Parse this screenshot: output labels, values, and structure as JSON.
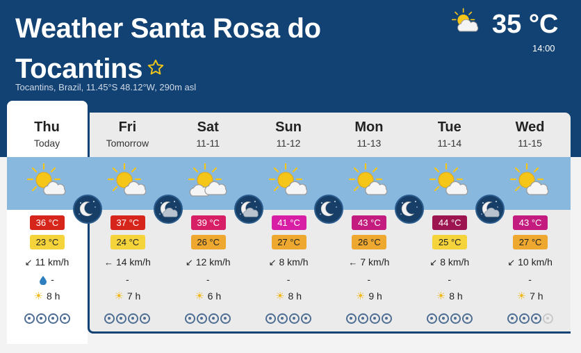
{
  "header": {
    "title": "Weather Santa Rosa do Tocantins",
    "subtitle": "Tocantins, Brazil, 11.45°S 48.12°W, 290m asl",
    "current_temp": "35 °C",
    "current_time": "14:00",
    "current_icon": "sun-cloud-icon",
    "favorite_icon": "star-outline-icon"
  },
  "colors": {
    "header_bg": "#124273",
    "sky_band": "#89b8df",
    "panel_bg": "#ebebeb",
    "uv_active": "#4e6e93",
    "uv_inactive": "#c9c9c9"
  },
  "days": [
    {
      "name": "Thu",
      "sub": "Today",
      "max": "36 °C",
      "max_color": "#d6261b",
      "min": "23 °C",
      "min_color": "#f5d33a",
      "wind_dir": "↙",
      "wind": "11 km/h",
      "rain": "-",
      "rain_icon": true,
      "sun": "8 h",
      "uv": 4,
      "weather_icon": "sun-cloud-icon"
    },
    {
      "name": "Fri",
      "sub": "Tomorrow",
      "max": "37 °C",
      "max_color": "#d6261b",
      "min": "24 °C",
      "min_color": "#f5d33a",
      "wind_dir": "←",
      "wind": "14 km/h",
      "rain": "-",
      "rain_icon": false,
      "sun": "7 h",
      "uv": 4,
      "weather_icon": "sun-cloud-icon"
    },
    {
      "name": "Sat",
      "sub": "11-11",
      "max": "39 °C",
      "max_color": "#d71f66",
      "min": "26 °C",
      "min_color": "#eea82f",
      "wind_dir": "↙",
      "wind": "12 km/h",
      "rain": "-",
      "rain_icon": false,
      "sun": "6 h",
      "uv": 4,
      "weather_icon": "sun-clouds-icon"
    },
    {
      "name": "Sun",
      "sub": "11-12",
      "max": "41 °C",
      "max_color": "#d81ea5",
      "min": "27 °C",
      "min_color": "#eea82f",
      "wind_dir": "↙",
      "wind": "8 km/h",
      "rain": "-",
      "rain_icon": false,
      "sun": "8 h",
      "uv": 4,
      "weather_icon": "sun-cloud-icon"
    },
    {
      "name": "Mon",
      "sub": "11-13",
      "max": "43 °C",
      "max_color": "#c41c7e",
      "min": "26 °C",
      "min_color": "#eea82f",
      "wind_dir": "←",
      "wind": "7 km/h",
      "rain": "-",
      "rain_icon": false,
      "sun": "9 h",
      "uv": 4,
      "weather_icon": "sun-cloud-icon"
    },
    {
      "name": "Tue",
      "sub": "11-14",
      "max": "44 °C",
      "max_color": "#9c1450",
      "min": "25 °C",
      "min_color": "#f5d33a",
      "wind_dir": "↙",
      "wind": "8 km/h",
      "rain": "-",
      "rain_icon": false,
      "sun": "8 h",
      "uv": 4,
      "weather_icon": "sun-cloud-icon"
    },
    {
      "name": "Wed",
      "sub": "11-15",
      "max": "43 °C",
      "max_color": "#c41c7e",
      "min": "27 °C",
      "min_color": "#eea82f",
      "wind_dir": "↙",
      "wind": "10 km/h",
      "rain": "-",
      "rain_icon": false,
      "sun": "7 h",
      "uv": 3,
      "weather_icon": "sun-cloud-icon"
    }
  ],
  "nights": [
    {
      "icon": "moon-clear-icon"
    },
    {
      "icon": "moon-cloud-icon"
    },
    {
      "icon": "moon-cloud-icon"
    },
    {
      "icon": "moon-clear-icon"
    },
    {
      "icon": "moon-clear-icon"
    },
    {
      "icon": "moon-cloud-icon"
    }
  ]
}
